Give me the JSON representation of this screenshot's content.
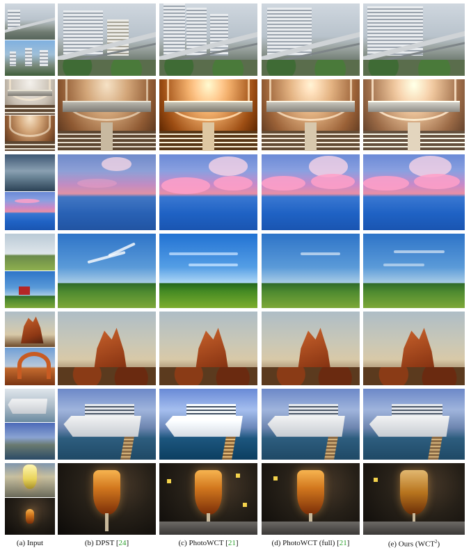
{
  "figure": {
    "captions": [
      {
        "label": "(a) Input",
        "ref": ""
      },
      {
        "label": "(b) DPST",
        "ref": "24"
      },
      {
        "label": "(c) PhotoWCT",
        "ref": "21"
      },
      {
        "label": "(d) PhotoWCT (full)",
        "ref": "21"
      },
      {
        "label": "(e) Ours (WCT",
        "sup": "2",
        "close": ")"
      }
    ],
    "rows": [
      "city",
      "church",
      "sea",
      "meadow",
      "rock",
      "ship",
      "glass"
    ]
  }
}
